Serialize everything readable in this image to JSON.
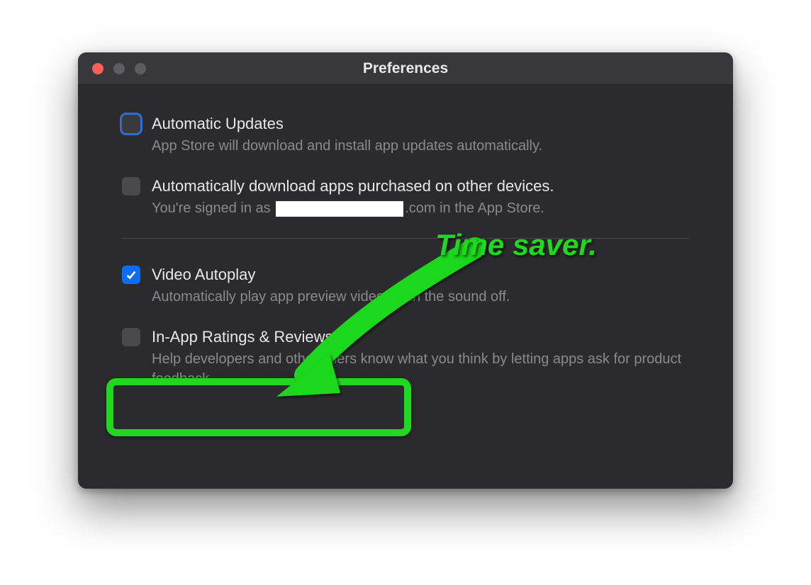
{
  "window": {
    "title": "Preferences"
  },
  "settings": {
    "auto_updates": {
      "label": "Automatic Updates",
      "description": "App Store will download and install app updates automatically.",
      "checked": false,
      "focused": true
    },
    "auto_download": {
      "label": "Automatically download apps purchased on other devices.",
      "description_prefix": "You're signed in as ",
      "description_suffix": ".com in the App Store.",
      "checked": false
    },
    "video_autoplay": {
      "label": "Video Autoplay",
      "description": "Automatically play app preview videos with the sound off.",
      "checked": true
    },
    "ratings_reviews": {
      "label": "In-App Ratings & Reviews",
      "description": "Help developers and other users know what you think by letting apps ask for product feedback.",
      "checked": false
    }
  },
  "annotation": {
    "text": "Time saver."
  }
}
